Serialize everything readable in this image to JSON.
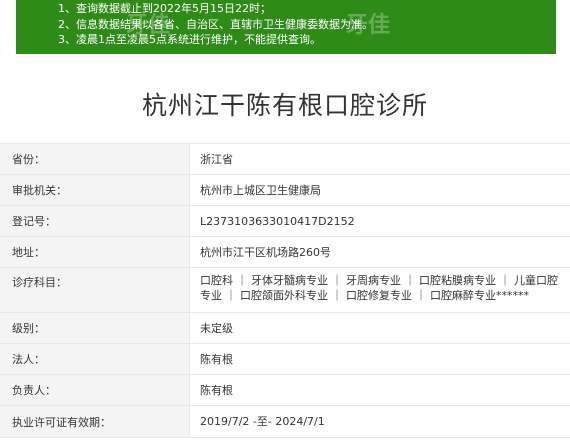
{
  "notice": {
    "lines": [
      "1、查询数据截止到2022年5月15日22时；",
      "2、信息数据结果以各省、自治区、直辖市卫生健康委数据为准。",
      "3、凌晨1点至凌晨5点系统进行维护，不能提供查询。"
    ],
    "watermark": "牙佳",
    "bg_color": "#2e8b17"
  },
  "title": "杭州江干陈有根口腔诊所",
  "rows": [
    {
      "label": "省份：",
      "value": "浙江省"
    },
    {
      "label": "审批机关：",
      "value": "杭州市上城区卫生健康局"
    },
    {
      "label": "登记号：",
      "value": "L2373103633010417D2152"
    },
    {
      "label": "地址：",
      "value": "杭州市江干区机场路260号"
    },
    {
      "label": "诊疗科目：",
      "value": "口腔科 ｜ 牙体牙髓病专业 ｜ 牙周病专业 ｜ 口腔粘膜病专业 ｜ 儿童口腔专业 ｜ 口腔颌面外科专业 ｜ 口腔修复专业 ｜ 口腔麻醉专业******"
    },
    {
      "label": "级别：",
      "value": "未定级"
    },
    {
      "label": "法人：",
      "value": "陈有根"
    },
    {
      "label": "负责人：",
      "value": "陈有根"
    },
    {
      "label": "执业许可证有效期：",
      "value": "2019/7/2 -至- 2024/7/1"
    }
  ]
}
